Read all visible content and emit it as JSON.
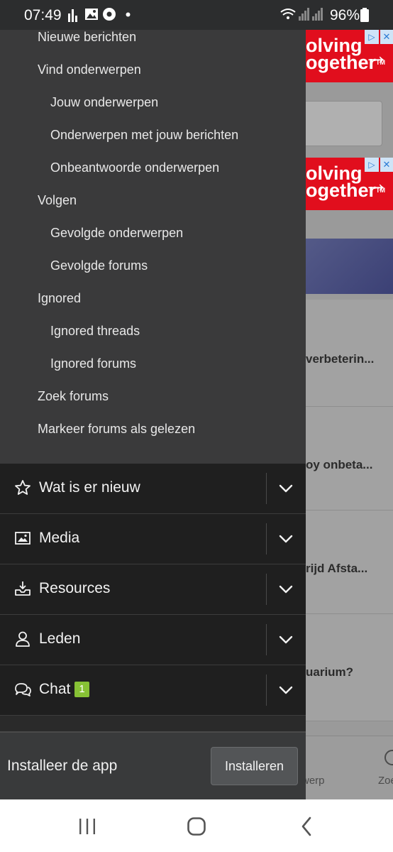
{
  "status_bar": {
    "time": "07:49",
    "battery": "96%",
    "icons": [
      "bar-chart-icon",
      "image-icon",
      "chrome-icon",
      "dot-icon",
      "wifi-icon",
      "signal-icon",
      "signal-icon",
      "battery-icon"
    ]
  },
  "background_page": {
    "ad_text_line1": "olving",
    "ad_text_line2": "ogether",
    "ad_tm": "TM",
    "threads": [
      "verbeterin...",
      "oy onbeta...",
      "rijd Afsta...",
      "uarium?"
    ],
    "tab_labels": [
      "werp",
      "Zoe"
    ]
  },
  "drawer": {
    "sub_links": [
      {
        "label": "Nieuwe berichten",
        "level": 1
      },
      {
        "label": "Vind onderwerpen",
        "level": 1
      },
      {
        "label": "Jouw onderwerpen",
        "level": 2
      },
      {
        "label": "Onderwerpen met jouw berichten",
        "level": 2
      },
      {
        "label": "Onbeantwoorde onderwerpen",
        "level": 2
      },
      {
        "label": "Volgen",
        "level": 1
      },
      {
        "label": "Gevolgde onderwerpen",
        "level": 2
      },
      {
        "label": "Gevolgde forums",
        "level": 2
      },
      {
        "label": "Ignored",
        "level": 1
      },
      {
        "label": "Ignored threads",
        "level": 2
      },
      {
        "label": "Ignored forums",
        "level": 2
      },
      {
        "label": "Zoek forums",
        "level": 1
      },
      {
        "label": "Markeer forums als gelezen",
        "level": 1
      }
    ],
    "nav_rows": [
      {
        "label": "Wat is er nieuw",
        "icon": "star-icon"
      },
      {
        "label": "Media",
        "icon": "image-icon"
      },
      {
        "label": "Resources",
        "icon": "download-tray-icon"
      },
      {
        "label": "Leden",
        "icon": "user-icon"
      },
      {
        "label": "Chat",
        "icon": "chat-bubbles-icon",
        "badge": "1"
      }
    ],
    "install_text": "Installeer de app",
    "install_button": "Installeren"
  },
  "colors": {
    "drawer_bg": "#2a2a2a",
    "submenu_bg": "#3a3a3b",
    "badge": "#87c135",
    "ad_red": "#e10e1d"
  }
}
